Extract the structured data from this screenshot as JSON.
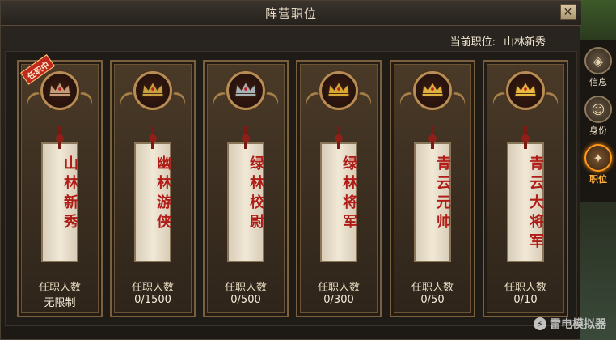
{
  "window": {
    "title": "阵营职位",
    "close_label": "✕"
  },
  "current_position": {
    "label": "当前职位:",
    "value": "山林新秀"
  },
  "ranks": [
    {
      "name": "山林新秀",
      "count_label": "任职人数",
      "count": "无限制",
      "badge": "任职中",
      "crown_color": "#c49a78"
    },
    {
      "name": "幽林游侠",
      "count_label": "任职人数",
      "count": "0/1500",
      "badge": "",
      "crown_color": "#c8a040"
    },
    {
      "name": "绿林校尉",
      "count_label": "任职人数",
      "count": "0/500",
      "badge": "",
      "crown_color": "#a8b0b8"
    },
    {
      "name": "绿林将军",
      "count_label": "任职人数",
      "count": "0/300",
      "badge": "",
      "crown_color": "#d8a830"
    },
    {
      "name": "青云元帅",
      "count_label": "任职人数",
      "count": "0/50",
      "badge": "",
      "crown_color": "#e0b040"
    },
    {
      "name": "青云大将军",
      "count_label": "任职人数",
      "count": "0/10",
      "badge": "",
      "crown_color": "#e8b840"
    }
  ],
  "side_tabs": [
    {
      "label": "信息",
      "icon": "map-icon",
      "active": false
    },
    {
      "label": "身份",
      "icon": "portrait-icon",
      "active": false
    },
    {
      "label": "职位",
      "icon": "emblem-icon",
      "active": true
    }
  ],
  "watermark": {
    "text": "雷电模拟器"
  }
}
